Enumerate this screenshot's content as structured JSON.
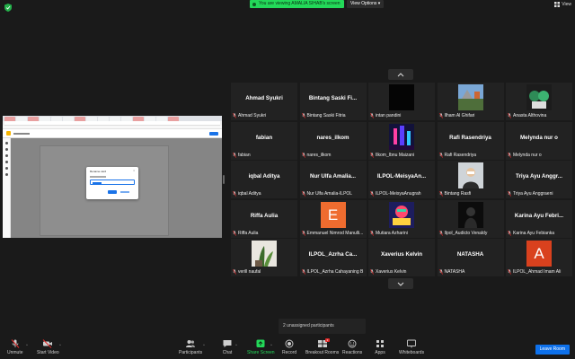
{
  "top_bar": {
    "share_banner": "You are viewing AMALIA SIHAB's screen",
    "view_options": "View Options ▾",
    "view_button": "View"
  },
  "gallery": {
    "participants": [
      {
        "big": "Ahmad Syukri",
        "label": "Ahmad Syukri"
      },
      {
        "big": "Bintang Saski Fi...",
        "label": "Bintang Saski Fitria"
      },
      {
        "big": "",
        "label": "intan pandini",
        "photo": "black"
      },
      {
        "big": "",
        "label": "Ilham Al Ghifari",
        "photo": "landscape"
      },
      {
        "big": "",
        "label": "Anasta Althovina",
        "photo": "cartoon"
      },
      {
        "big": "fabian",
        "label": "fabian"
      },
      {
        "big": "nares_ilkom",
        "label": "nares_ilkom"
      },
      {
        "big": "",
        "label": "Ilkom_Ibnu Maizani",
        "photo": "neon"
      },
      {
        "big": "Rafi Rasendriya",
        "label": "Rafi Rasendriya"
      },
      {
        "big": "Melynda nur o",
        "label": "Melynda nur o"
      },
      {
        "big": "iqbal Aditya",
        "label": "iqbal Aditya"
      },
      {
        "big": "Nur Ulfa Amalia...",
        "label": "Nur Ulfa Amalia-ILPOL"
      },
      {
        "big": "ILPOL-MeisyaAn...",
        "label": "ILPOL-MeisyaAnugrah"
      },
      {
        "big": "",
        "label": "Bintang Rasfi",
        "photo": "person"
      },
      {
        "big": "Triya Ayu Anggr...",
        "label": "Triya Ayu Anggraeni"
      },
      {
        "big": "Riffa Aulia",
        "label": "Riffa Aulia"
      },
      {
        "big": "",
        "label": "Emmanuel Nimrod Manulli...",
        "letter": "E",
        "letter_color": "#ef6c2f"
      },
      {
        "big": "",
        "label": "Mutiara Azharini",
        "photo": "colorful"
      },
      {
        "big": "",
        "label": "Ilpol_Audicto Venaldy",
        "photo": "dark"
      },
      {
        "big": "Karina Ayu Febri...",
        "label": "Karina Ayu Febianka"
      },
      {
        "big": "",
        "label": "verill naufal",
        "photo": "plant"
      },
      {
        "big": "ILPOL_Azrha Ca...",
        "label": "ILPOL_Azrha Cahayaning B"
      },
      {
        "big": "Xaverius Kelvin",
        "label": "Xaverius Kelvin"
      },
      {
        "big": "NATASHA",
        "label": "NATASHA"
      },
      {
        "big": "",
        "label": "ILPOL_Ahmad Imam Ali",
        "letter": "A",
        "letter_color": "#d9411e"
      }
    ]
  },
  "unassigned": "2 unassigned participants",
  "toolbar": {
    "unmute": "Unmute",
    "start_video": "Start Video",
    "participants": "Participants",
    "participants_count": "42",
    "chat": "Chat",
    "share_screen": "Share Screen",
    "record": "Record",
    "breakout_rooms": "Breakout Rooms",
    "reactions": "Reactions",
    "apps": "Apps",
    "whiteboards": "Whiteboards",
    "leave_room": "Leave Room"
  },
  "colors": {
    "banner_green": "#23d959",
    "leave_blue": "#0e71eb",
    "muted_red": "#e02828"
  }
}
